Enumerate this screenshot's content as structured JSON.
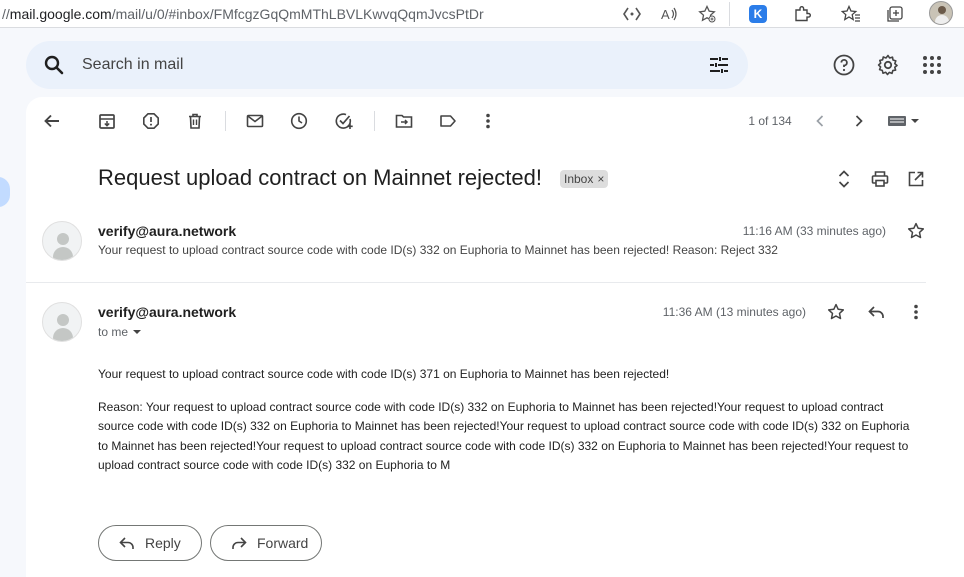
{
  "browser": {
    "url_host": "mail.google.com",
    "url_path": "/mail/u/0/#inbox/FMfcgzGqQmMThLBVLKwvqQqmJvcsPtDr",
    "url_prefix": "//",
    "extension_label": "K"
  },
  "search": {
    "placeholder": "Search in mail"
  },
  "toolbar": {
    "pager": "1 of 134"
  },
  "thread": {
    "subject": "Request upload contract on Mainnet rejected!",
    "label": "Inbox",
    "label_remove": "×"
  },
  "messages": [
    {
      "sender": "verify@aura.network",
      "time": "11:16 AM (33 minutes ago)",
      "snippet": "Your request to upload contract source code with code ID(s) 332 on Euphoria to Mainnet has been rejected! Reason: Reject 332"
    },
    {
      "sender": "verify@aura.network",
      "time": "11:36 AM (13 minutes ago)",
      "recipient": "to me",
      "body_line1": "Your request to upload contract source code with code ID(s) 371 on Euphoria to Mainnet has been rejected!",
      "body_reason": "Reason: Your request to upload contract source code with code ID(s) 332 on Euphoria to Mainnet has been rejected!Your request to upload contract source code with code ID(s) 332 on Euphoria to Mainnet has been rejected!Your request to upload contract source code with code ID(s) 332 on Euphoria to Mainnet has been rejected!Your request to upload contract source code with code ID(s) 332 on Euphoria to Mainnet has been rejected!Your request to upload contract source code with code ID(s) 332 on Euphoria to M"
    }
  ],
  "actions": {
    "reply": "Reply",
    "forward": "Forward"
  },
  "colors": {
    "accent": "#0b57d0",
    "search_bg": "#eaf1fb",
    "page_bg": "#f6f8fc",
    "label_chip": "#dddddd"
  }
}
